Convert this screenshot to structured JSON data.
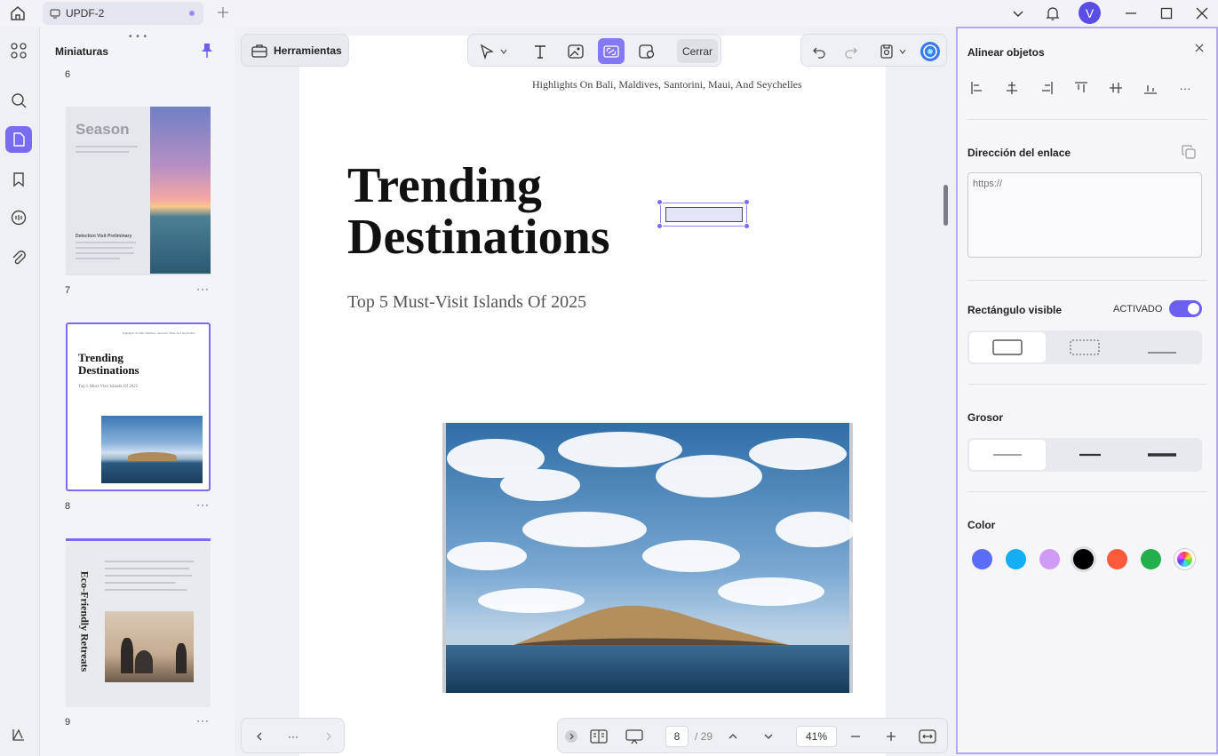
{
  "titlebar": {
    "tab_title": "UPDF-2",
    "avatar_letter": "V"
  },
  "thumbnails": {
    "title": "Miniaturas",
    "top_page_fragment": "6",
    "pages": [
      {
        "number": "7",
        "heading": "Season",
        "footer": "Detection Visit Preliminary"
      },
      {
        "number": "8",
        "heading_line1": "Trending",
        "heading_line2": "Destinations",
        "subtitle": "Top 5 Must-Visit Islands Of 2025",
        "header": "Highlights On Bali, Maldives, Santorini, Maui, And Seychelles"
      },
      {
        "number": "9",
        "vertical_heading": "Eco-Friendly Retreats"
      }
    ]
  },
  "toolbar": {
    "tools_label": "Herramientas",
    "close_label": "Cerrar"
  },
  "page": {
    "header_line": "Highlights On Bali, Maldives, Santorini, Maui, And  Seychelles",
    "title_line1": "Trending",
    "title_line2": "Destinations",
    "subtitle": "Top 5 Must-Visit Islands Of 2025"
  },
  "bottom": {
    "more_label": "···",
    "current_page": "8",
    "total_pages": "/ 29",
    "zoom": "41%"
  },
  "properties": {
    "align_title": "Alinear objetos",
    "more_label": "···",
    "link_title": "Dirección del enlace",
    "url_placeholder": "https://",
    "visible_rect_title": "Rectángulo visible",
    "toggle_state": "ACTIVADO",
    "thickness_title": "Grosor",
    "color_title": "Color",
    "colors": [
      "#5b6cf6",
      "#16aef3",
      "#cf9bf5",
      "#000000",
      "#fb5a3c",
      "#21b04b",
      "rainbow"
    ],
    "selected_color": "#000000"
  }
}
